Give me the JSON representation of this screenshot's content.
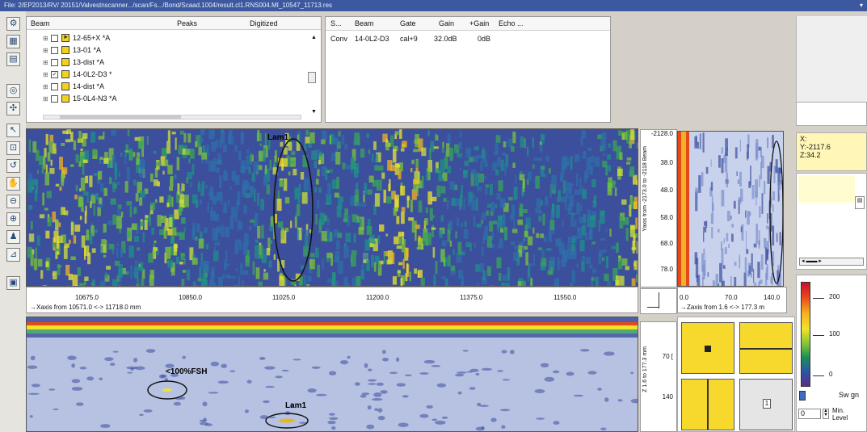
{
  "window": {
    "title": "File: 2/EP2013/RV/ 20151/Valvestnscanner.../scan/Fs.../Bond/Scaad.1004/result.cl1.RNS004.MI_10547_11713.res",
    "close": "▾"
  },
  "tree": {
    "headers": {
      "beam": "Beam",
      "peaks": "Peaks",
      "digitized": "Digitized"
    },
    "items": [
      {
        "label": "12-65+X *A",
        "checked": false
      },
      {
        "label": "13-01 *A",
        "checked": false
      },
      {
        "label": "13-dist *A",
        "checked": false
      },
      {
        "label": "14-0L2-D3 *",
        "checked": true
      },
      {
        "label": "14-dist *A",
        "checked": false
      },
      {
        "label": "15-0L4-N3 *A",
        "checked": false
      }
    ]
  },
  "gates": {
    "headers": {
      "s": "S...",
      "beam": "Beam",
      "gate": "Gate",
      "gain": "Gain",
      "plus_gain": "+Gain",
      "echo": "Echo ..."
    },
    "row": {
      "s": "Conv",
      "beam": "14-0L2-D3",
      "gate": "cal+9",
      "gain": "32.0dB",
      "plus_gain": "0dB"
    }
  },
  "cscan": {
    "x_ticks": [
      "10675.0",
      "10850.0",
      "11025.0",
      "11200.0",
      "11375.0",
      "11550.0"
    ],
    "x_range_label": "→Xaxis from 10571.0 <-> 11718.0 mm",
    "y_ticks": [
      "-2128.0",
      "38.0",
      "48.0",
      "58.0",
      "68.0",
      "78.0"
    ],
    "y_range_label": "Yaxis from -2173.0 to -2118 Beam",
    "annotation": "Lam1"
  },
  "side": {
    "x_ticks": [
      "0.0",
      "70.0",
      "140.0"
    ],
    "x_range_label": "→Zaxis from 1.6 <-> 177.3 m"
  },
  "info": {
    "x": "X:",
    "y": "Y:-2117.6",
    "z": "Z:34.2"
  },
  "bscan": {
    "y_ticks": [
      "70 [",
      "140"
    ],
    "y_range_label": "Z 1.6 to 177.3 mm",
    "annotations": [
      "<100%FSH",
      "Lam1"
    ]
  },
  "legend": {
    "ticks": [
      "200",
      "100",
      "0"
    ],
    "swing": "Sw gn",
    "min_value": "0",
    "min_label": [
      "Min.",
      "Level"
    ]
  },
  "colors": {
    "accent": "#3c59a0",
    "indicator": "#f7d92e",
    "scan_blue": "#3c4f9c"
  }
}
